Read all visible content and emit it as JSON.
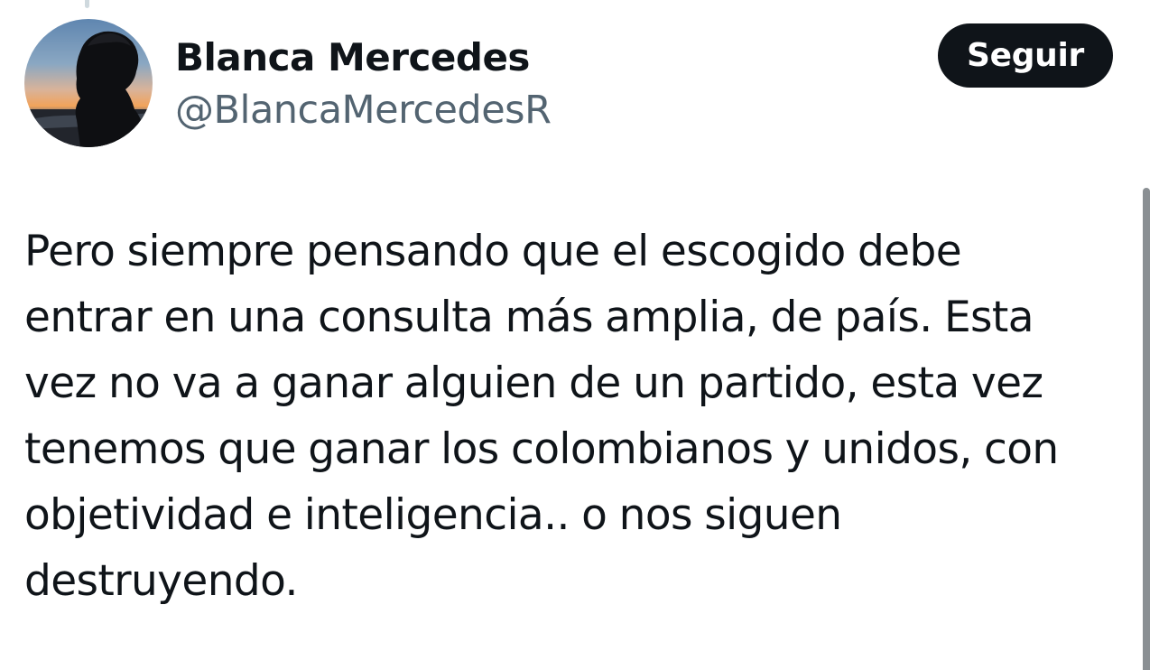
{
  "tweet": {
    "author": {
      "display_name": "Blanca Mercedes",
      "handle": "@BlancaMercedesR",
      "avatar_icon": "profile-photo-silhouette-sunset"
    },
    "follow_label": "Seguir",
    "text": "Pero siempre pensando que el escogido debe\nentrar en una consulta más amplia, de país. Esta\nvez no va a ganar alguien de un partido, esta vez\ntenemos que ganar los colombianos y unidos, con\nobjetividad e inteligencia.. o nos siguen\ndestruyendo."
  },
  "colors": {
    "text_primary": "#0f1419",
    "text_secondary": "#536471",
    "button_bg": "#0f1419",
    "button_text": "#ffffff",
    "background": "#ffffff"
  }
}
